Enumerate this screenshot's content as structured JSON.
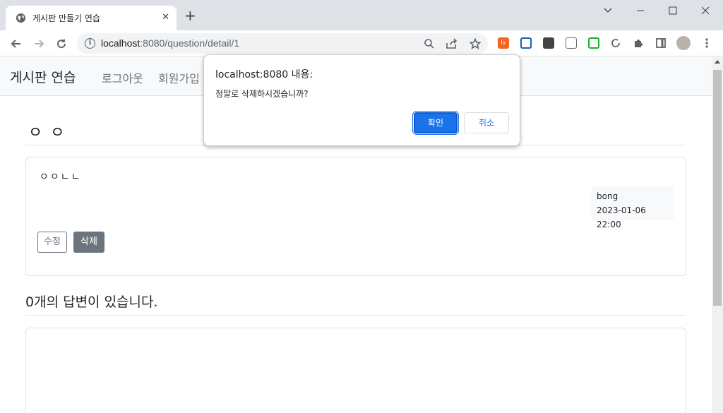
{
  "browser": {
    "tab_title": "게시판 만들기 연습",
    "url_host": "localhost",
    "url_path": ":8080/question/detail/1"
  },
  "page": {
    "brand": "게시판 연습",
    "nav_links": [
      "로그아웃",
      "회원가입"
    ],
    "question": {
      "subject": "ㅇ ㅇ",
      "content": "ㅇㅇㄴㄴ",
      "author": "bong",
      "date": "2023-01-06 22:00",
      "edit_label": "수정",
      "delete_label": "삭제"
    },
    "answers_count_text": "0개의 답변이 있습니다."
  },
  "dialog": {
    "title": "localhost:8080 내용:",
    "message": "정말로 삭제하시겠습니까?",
    "ok_label": "확인",
    "cancel_label": "취소"
  },
  "colors": {
    "accent": "#1a73e8",
    "secondary_button": "#6c757d",
    "navbar_bg": "#f8f9fa"
  }
}
